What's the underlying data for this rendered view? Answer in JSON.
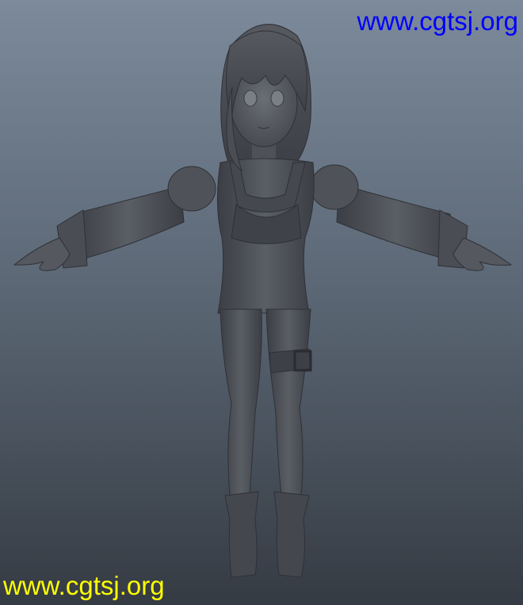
{
  "watermark": {
    "top_text": "www.cgtsj.org",
    "bottom_text": "www.cgtsj.org",
    "top_color": "#0000ff",
    "bottom_color": "#ffff00"
  },
  "scene": {
    "subject": "t-pose-character-model",
    "model_color": "#4b4e54",
    "model_highlight": "#6b6f76",
    "model_shadow": "#33363b"
  }
}
